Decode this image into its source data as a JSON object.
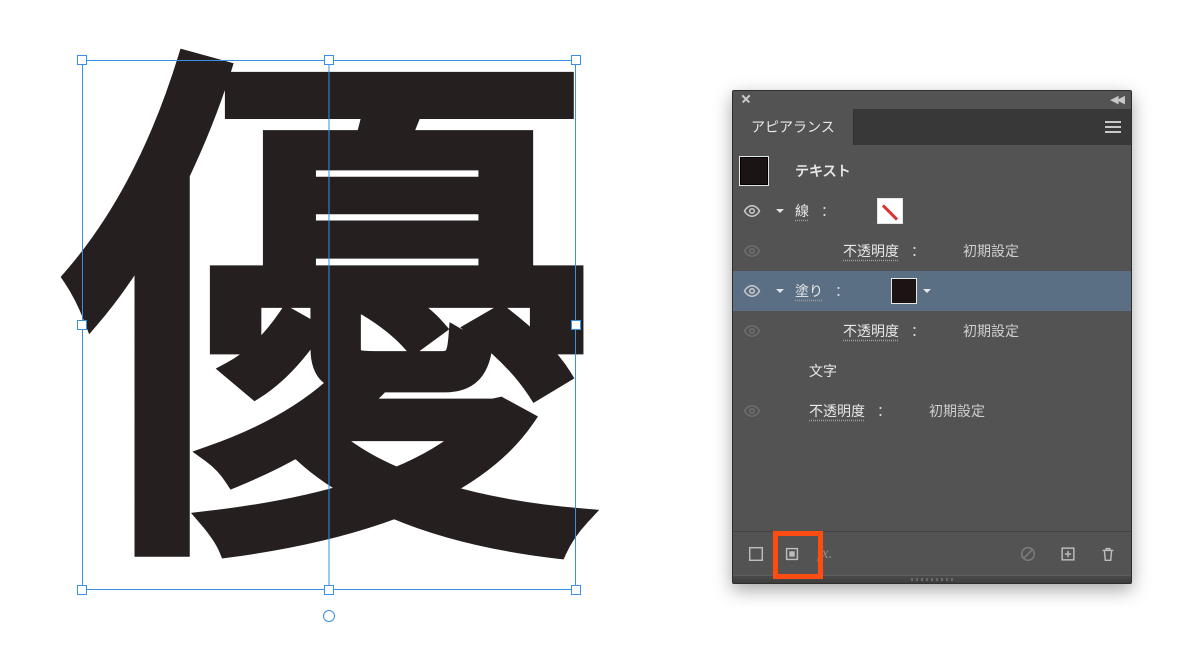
{
  "canvas": {
    "glyph": "優"
  },
  "panel": {
    "title": "アピアランス",
    "object_label": "テキスト",
    "rows": {
      "stroke": {
        "label": "線",
        "opacity_label": "不透明度",
        "opacity_value": "初期設定"
      },
      "fill": {
        "label": "塗り",
        "opacity_label": "不透明度",
        "opacity_value": "初期設定"
      },
      "characters": {
        "label": "文字"
      },
      "opacity": {
        "label": "不透明度",
        "value": "初期設定"
      }
    }
  }
}
